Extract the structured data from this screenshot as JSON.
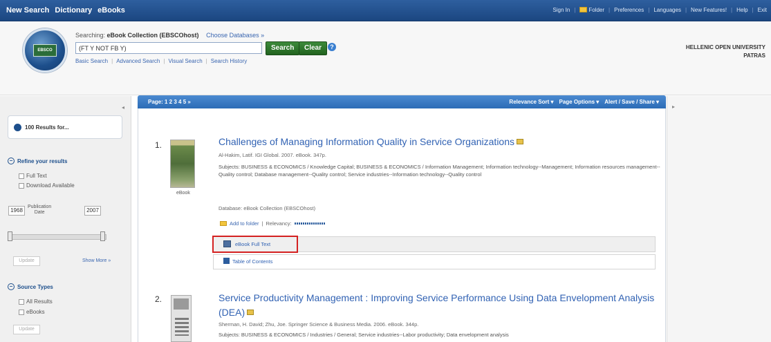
{
  "topnav": {
    "items": [
      "New Search",
      "Dictionary",
      "eBooks"
    ]
  },
  "toplinks": {
    "signin": "Sign In",
    "folder": "Folder",
    "preferences": "Preferences",
    "languages": "Languages",
    "new_features": "New Features!",
    "help": "Help",
    "exit": "Exit"
  },
  "search": {
    "searching_label": "Searching:",
    "database": "eBook Collection (EBSCOhost)",
    "choose_databases": "Choose Databases »",
    "query": "(FT Y NOT FB Y)",
    "search_button": "Search",
    "clear_button": "Clear",
    "help_symbol": "?",
    "links": [
      "Basic Search",
      "Advanced Search",
      "Visual Search",
      "Search History"
    ]
  },
  "institution": {
    "line1": "HELLENIC OPEN UNIVERSITY",
    "line2": "PATRAS"
  },
  "logo": {
    "text": "EBSCO"
  },
  "sidebar": {
    "results_for": "100 Results for...",
    "refine_title": "Refine your results",
    "refine_options": [
      "Full Text",
      "Download Available"
    ],
    "year_from": "1968",
    "year_to": "2007",
    "pub_date_label_1": "Publication",
    "pub_date_label_2": "Date",
    "update_label": "Update",
    "show_more": "Show More »",
    "source_types_title": "Source Types",
    "source_options": [
      "All Results",
      "eBooks"
    ]
  },
  "results_toolbar": {
    "pages": "Page: 1 2 3 4 5 »",
    "sort": "Relevance Sort ▾",
    "page_options": "Page Options ▾",
    "alert": "Alert / Save / Share ▾"
  },
  "results": [
    {
      "number": "1.",
      "title": "Challenges of Managing Information Quality in Service Organizations",
      "meta": "Al-Hakim, Latif. IGI Global. 2007. eBook. 347p.",
      "subjects": "Subjects: BUSINESS & ECONOMICS / Knowledge Capital; BUSINESS & ECONOMICS / Information Management; Information technology--Management; Information resources management--Quality control; Database management--Quality control; Service industries--Information technology--Quality control",
      "database": "Database: eBook Collection (EBSCOhost)",
      "thumb_label": "eBook",
      "add_to_folder": "Add to folder",
      "relevancy": "Relevancy:",
      "fulltext": "eBook Full Text",
      "toc": "Table of Contents"
    },
    {
      "number": "2.",
      "title": "Service Productivity Management : Improving Service Performance Using Data Envelopment Analysis (DEA)",
      "meta": "Sherman, H. David; Zhu, Joe. Springer Science & Business Media. 2006. eBook. 344p.",
      "subjects": "Subjects: BUSINESS & ECONOMICS / Industries / General; Service industries--Labor productivity; Data envelopment analysis"
    }
  ]
}
